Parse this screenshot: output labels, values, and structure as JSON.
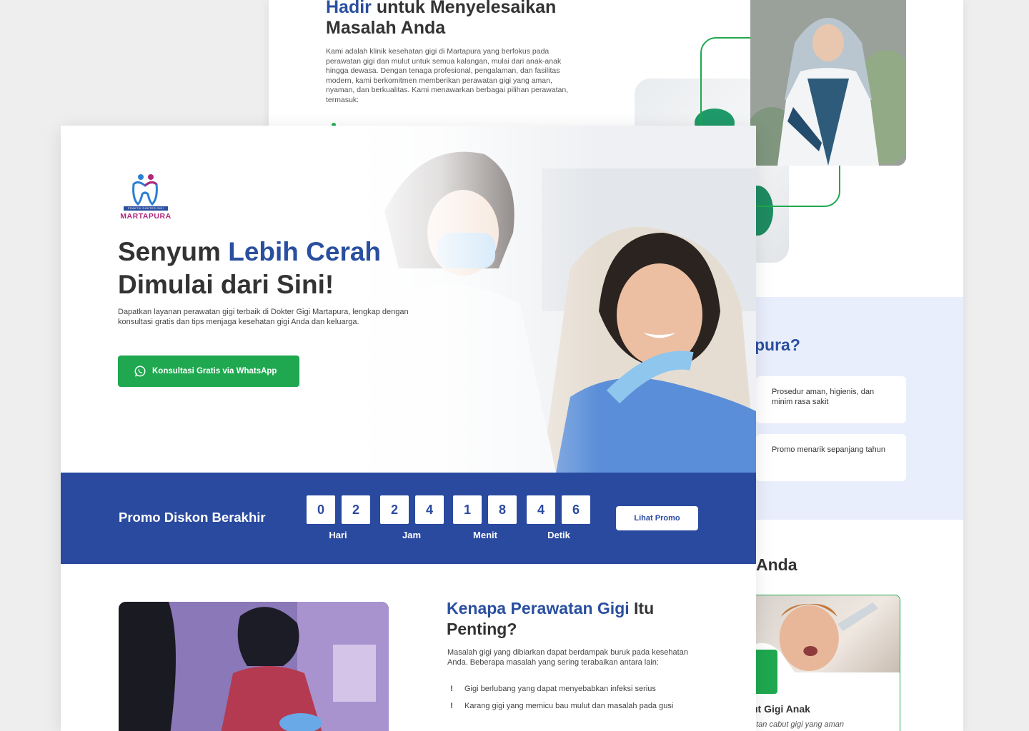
{
  "back_page": {
    "title_accent": "Hadir",
    "title_rest": " untuk Menyelesaikan Masalah Anda",
    "paragraph": "Kami adalah klinik kesehatan gigi di Martapura yang berfokus pada perawatan gigi dan mulut untuk semua kalangan, mulai dari anak-anak hingga dewasa. Dengan tenaga profesional, pengalaman, dan fasilitas modern, kami berkomitmen memberikan perawatan gigi yang aman, nyaman, dan berkualitas. Kami menawarkan berbagai pilihan perawatan, termasuk:",
    "why_title": "pura?",
    "why_cards": [
      "Prosedur aman, higienis, dan minim rasa sakit",
      "Promo menarik sepanjang tahun"
    ],
    "services_title": "Anda",
    "service_card_title": "ut Gigi Anak",
    "service_card_desc": "otan cabut gigi yang aman"
  },
  "logo": {
    "tagline": "PRAKTIK DOKTER GIGI",
    "name": "MARTAPURA",
    "colors": {
      "blue": "#2a4fa0",
      "magenta": "#b0267a"
    }
  },
  "hero": {
    "title_line1_plain": "Senyum ",
    "title_line1_accent": "Lebih Cerah",
    "title_line2": "Dimulai dari Sini!",
    "subtitle": "Dapatkan layanan perawatan gigi terbaik di Dokter Gigi Martapura, lengkap dengan konsultasi gratis dan tips menjaga kesehatan gigi Anda dan keluarga.",
    "cta_label": "Konsultasi Gratis via WhatsApp",
    "cta_icon": "whatsapp-icon"
  },
  "promo": {
    "title": "Promo Diskon Berakhir",
    "digits": [
      "0",
      "2",
      "2",
      "4",
      "1",
      "8",
      "4",
      "6"
    ],
    "units": [
      "Hari",
      "Jam",
      "Menit",
      "Detik"
    ],
    "button_label": "Lihat Promo"
  },
  "care": {
    "title_accent": "Kenapa Perawatan Gigi",
    "title_rest": " Itu Penting?",
    "paragraph": "Masalah gigi yang dibiarkan dapat berdampak buruk pada kesehatan Anda. Beberapa masalah yang sering terabaikan antara lain:",
    "items": [
      "Gigi berlubang yang dapat menyebabkan infeksi serius",
      "Karang gigi yang memicu bau mulut dan masalah pada gusi"
    ]
  },
  "colors": {
    "primary_blue": "#2a4aa0",
    "accent_green": "#1fa84f",
    "soft_blue_band": "#e9eefc"
  }
}
